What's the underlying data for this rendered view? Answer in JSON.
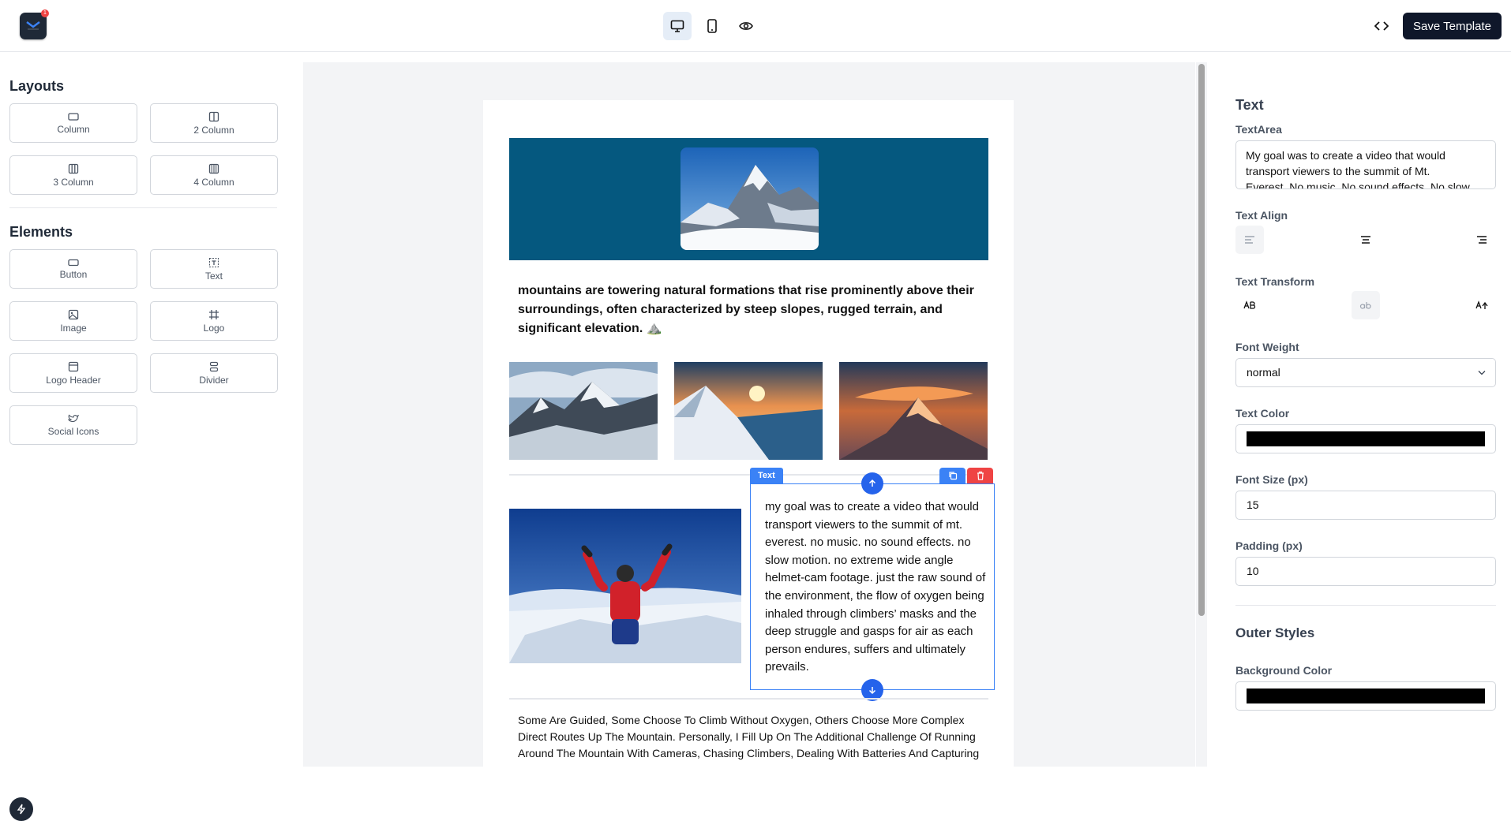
{
  "app": {
    "notification_count": "1"
  },
  "toolbar": {
    "save_label": "Save Template"
  },
  "left": {
    "layouts_title": "Layouts",
    "layouts": [
      "Column",
      "2 Column",
      "3 Column",
      "4 Column"
    ],
    "elements_title": "Elements",
    "elements": [
      "Button",
      "Text",
      "Image",
      "Logo",
      "Logo Header",
      "Divider",
      "Social Icons"
    ]
  },
  "canvas": {
    "lead_text": "mountains are towering natural formations that rise prominently above their surroundings, often characterized by steep slopes, rugged terrain, and significant elevation. ⛰️",
    "selected_tag": "Text",
    "body_text": "my goal was to create a video that would transport viewers to the summit of mt. everest. no music. no sound effects. no slow motion. no extreme wide angle helmet-cam footage. just the raw sound of the environment, the flow of oxygen being inhaled through climbers’ masks and the deep struggle and gasps for air as each person endures, suffers and ultimately prevails.",
    "footer_text": "Some Are Guided, Some Choose To Climb Without Oxygen, Others Choose More Complex Direct Routes Up The Mountain. Personally, I Fill Up On The Additional Challenge Of Running Around The Mountain With Cameras, Chasing Climbers, Dealing With Batteries And Capturing"
  },
  "right": {
    "title": "Text",
    "textarea_label": "TextArea",
    "textarea_value": "My goal was to create a video that would transport viewers to the summit of Mt. Everest. No music. No sound effects. No slow motion.",
    "text_align_label": "Text Align",
    "text_transform_label": "Text Transform",
    "font_weight_label": "Font Weight",
    "font_weight_value": "normal",
    "text_color_label": "Text Color",
    "text_color_value": "#000000",
    "font_size_label": "Font Size (px)",
    "font_size_value": "15",
    "padding_label": "Padding (px)",
    "padding_value": "10",
    "outer_styles_title": "Outer Styles",
    "bg_color_label": "Background Color",
    "bg_color_value": "#000000"
  },
  "colors": {
    "accent": "#3b82f6",
    "hero_bg": "#05587f",
    "dark": "#0f172a",
    "danger": "#ef4444"
  }
}
